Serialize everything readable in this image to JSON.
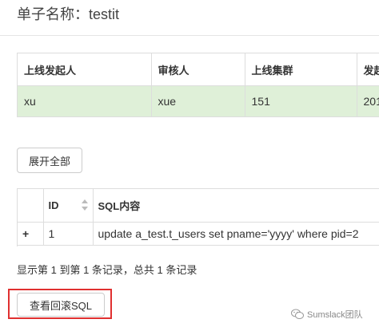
{
  "header": {
    "title": "单子名称：testit"
  },
  "summary_table": {
    "columns": [
      "上线发起人",
      "审核人",
      "上线集群",
      "发起"
    ],
    "row": [
      "xu",
      "xue",
      "151",
      "201"
    ]
  },
  "buttons": {
    "expand_all": "展开全部",
    "view_rollback_sql": "查看回滚SQL"
  },
  "sql_table": {
    "columns": [
      "",
      "ID",
      "SQL内容"
    ],
    "rows": [
      {
        "expand_icon": "+",
        "id": "1",
        "sql": "update a_test.t_users set pname='yyyy' where pid=2"
      }
    ]
  },
  "pagination": {
    "text": "显示第 1 到第 1 条记录，总共 1 条记录"
  },
  "watermark": {
    "text": "Sumslack团队",
    "icon": "wechat-icon"
  },
  "colors": {
    "row_highlight": "#dff0d8",
    "expand_icon": "#3a87c8",
    "highlight_border": "#e03030"
  }
}
